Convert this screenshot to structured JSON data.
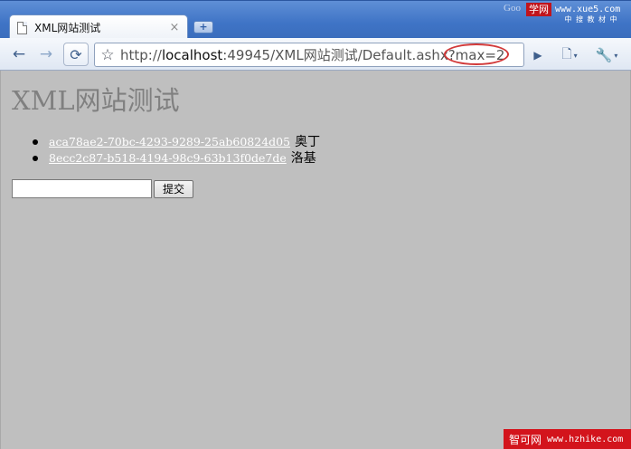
{
  "browser": {
    "google_label": "Goo",
    "tab": {
      "title": "XML网站测试",
      "close": "×"
    },
    "newtab_label": "+",
    "address": {
      "scheme": "http://",
      "host": "localhost",
      "path": ":49945/XML网站测试/Default.ashx?max=2"
    },
    "badge": {
      "red": "学网",
      "url": "www.xue5.com",
      "sub": "中 搜 教 材 中"
    }
  },
  "page": {
    "heading": "XML网站测试",
    "items": [
      {
        "link": "aca78ae2-70bc-4293-9289-25ab60824d05",
        "name": "奥丁"
      },
      {
        "link": "8ecc2c87-b518-4194-98c9-63b13f0de7de",
        "name": "洛基"
      }
    ],
    "input_value": "",
    "submit_label": "提交"
  },
  "watermark": {
    "name": "智可网",
    "url": "www.hzhike.com"
  },
  "icons": {
    "back": "←",
    "forward": "→",
    "reload": "⟳",
    "star": "☆",
    "go": "▶",
    "page": "🗋",
    "wrench": "🔧",
    "caret": "▾"
  },
  "colors": {
    "annotation": "#d23a3a",
    "watermark": "#d3141c",
    "page_bg": "#bfbfbf"
  }
}
